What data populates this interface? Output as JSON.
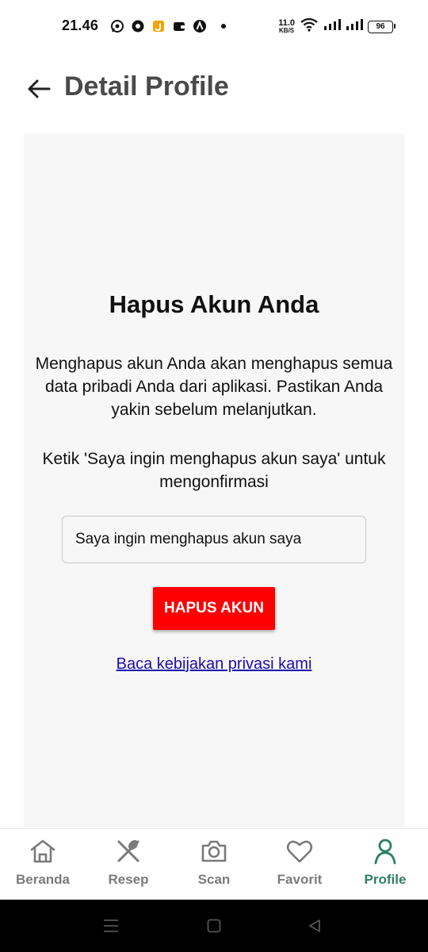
{
  "status_bar": {
    "time": "21.46",
    "net_speed_value": "11.0",
    "net_speed_unit": "KB/S",
    "battery": "96",
    "icons": [
      "whatsapp-icon",
      "chrome-icon",
      "app-j-icon",
      "wallet-icon",
      "location-a-icon",
      "wifi-icon",
      "signal-icon",
      "signal-icon",
      "battery-icon"
    ]
  },
  "header": {
    "back_icon": "arrow-left-icon",
    "title": "Detail Profile"
  },
  "card": {
    "title": "Hapus Akun Anda",
    "description": "Menghapus akun Anda akan menghapus semua data pribadi Anda dari aplikasi. Pastikan Anda yakin sebelum melanjutkan.",
    "instruction": "Ketik 'Saya ingin menghapus akun saya' untuk mengonfirmasi",
    "input_value": "Saya ingin menghapus akun saya",
    "delete_button_label": "HAPUS AKUN",
    "privacy_link": "Baca kebijakan privasi kami"
  },
  "bottom_nav": {
    "items": [
      {
        "label": "Beranda",
        "icon": "home-icon",
        "active": false
      },
      {
        "label": "Resep",
        "icon": "fork-knife-icon",
        "active": false
      },
      {
        "label": "Scan",
        "icon": "camera-icon",
        "active": false
      },
      {
        "label": "Favorit",
        "icon": "heart-icon",
        "active": false
      },
      {
        "label": "Profile",
        "icon": "person-icon",
        "active": true
      }
    ]
  },
  "colors": {
    "accent": "#2e7d64",
    "danger": "#ff0000",
    "link": "#1a0dab",
    "card_bg": "#f7f7f7",
    "inactive": "#7a7a7a"
  }
}
